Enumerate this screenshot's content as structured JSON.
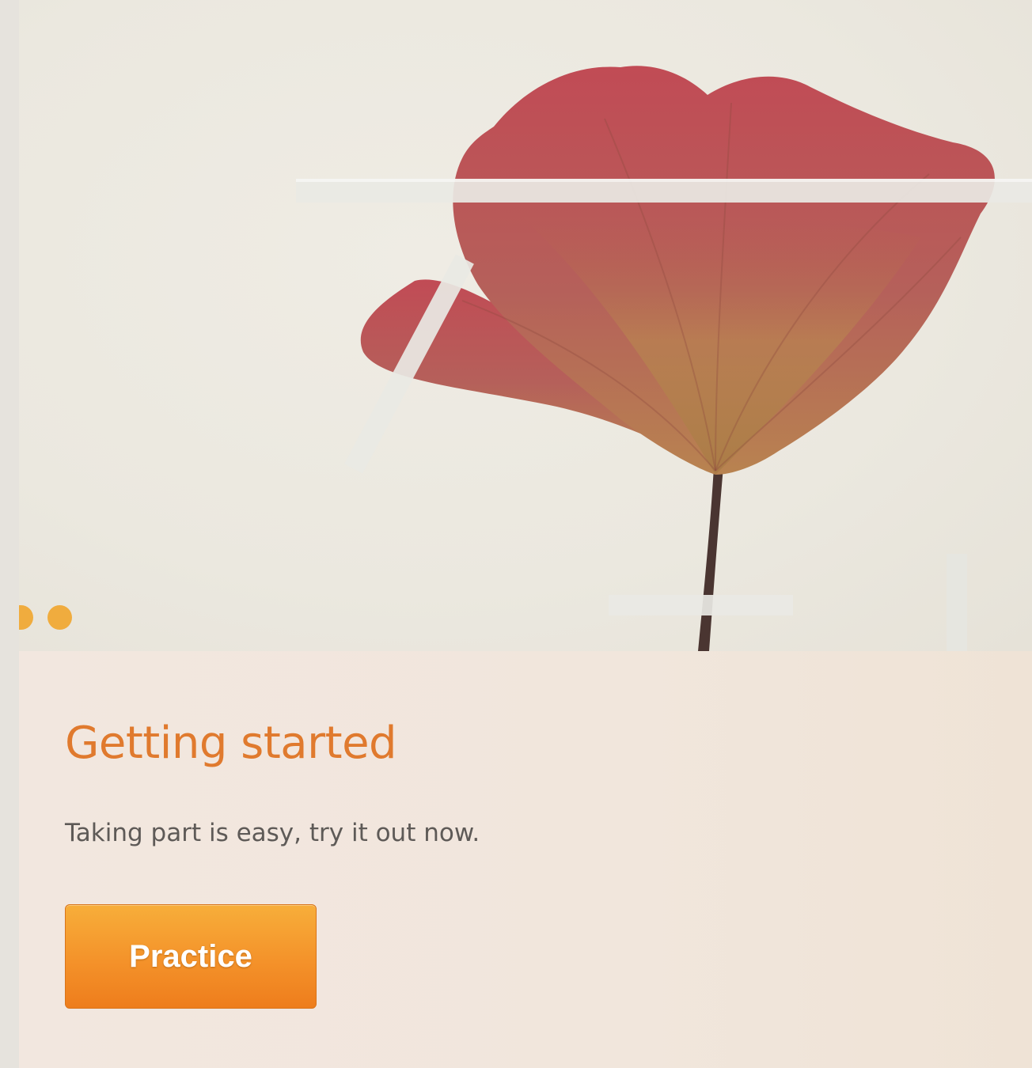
{
  "hero": {
    "image": "pressed-red-flower-on-paper",
    "carousel": {
      "slide_count": 2,
      "active_index": 1,
      "dot_color": "#f0ac3e"
    }
  },
  "section": {
    "title": "Getting started",
    "description": "Taking part is easy, try it out now.",
    "practice_label": "Practice"
  },
  "colors": {
    "title": "#e07a2e",
    "button": "#f4922a",
    "text": "#5e5a57"
  }
}
